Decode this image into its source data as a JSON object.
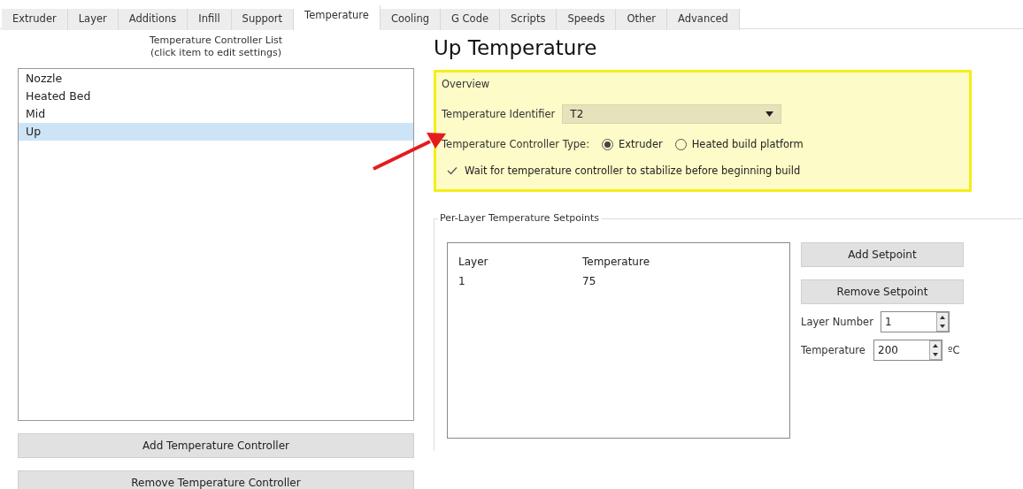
{
  "tabs": [
    {
      "label": "Extruder",
      "selected": false
    },
    {
      "label": "Layer",
      "selected": false
    },
    {
      "label": "Additions",
      "selected": false
    },
    {
      "label": "Infill",
      "selected": false
    },
    {
      "label": "Support",
      "selected": false
    },
    {
      "label": "Temperature",
      "selected": true
    },
    {
      "label": "Cooling",
      "selected": false
    },
    {
      "label": "G Code",
      "selected": false
    },
    {
      "label": "Scripts",
      "selected": false
    },
    {
      "label": "Speeds",
      "selected": false
    },
    {
      "label": "Other",
      "selected": false
    },
    {
      "label": "Advanced",
      "selected": false
    }
  ],
  "controller_list": {
    "title": "Temperature Controller List",
    "subtitle": "(click item to edit settings)",
    "items": [
      {
        "label": "Nozzle",
        "selected": false
      },
      {
        "label": "Heated Bed",
        "selected": false
      },
      {
        "label": "Mid",
        "selected": false
      },
      {
        "label": "Up",
        "selected": true
      }
    ],
    "buttons": [
      "Add Temperature Controller",
      "Remove Temperature Controller"
    ]
  },
  "heading": "Up Temperature",
  "overview": {
    "legend": "Overview",
    "identifier_label": "Temperature Identifier",
    "identifier_value": "T2",
    "type_label": "Temperature Controller Type:",
    "type_options": [
      {
        "label": "Extruder",
        "selected": true
      },
      {
        "label": "Heated build platform",
        "selected": false
      }
    ],
    "wait": {
      "label": "Wait for temperature controller to stabilize before beginning build",
      "checked": true
    }
  },
  "setpoints": {
    "legend": "Per-Layer Temperature Setpoints",
    "columns": [
      "Layer",
      "Temperature"
    ],
    "rows": [
      [
        "1",
        "75"
      ]
    ],
    "buttons": [
      "Add Setpoint",
      "Remove Setpoint"
    ],
    "layer_label": "Layer Number",
    "layer_value": "1",
    "temp_label": "Temperature",
    "temp_value": "200",
    "temp_unit": "ºC"
  }
}
